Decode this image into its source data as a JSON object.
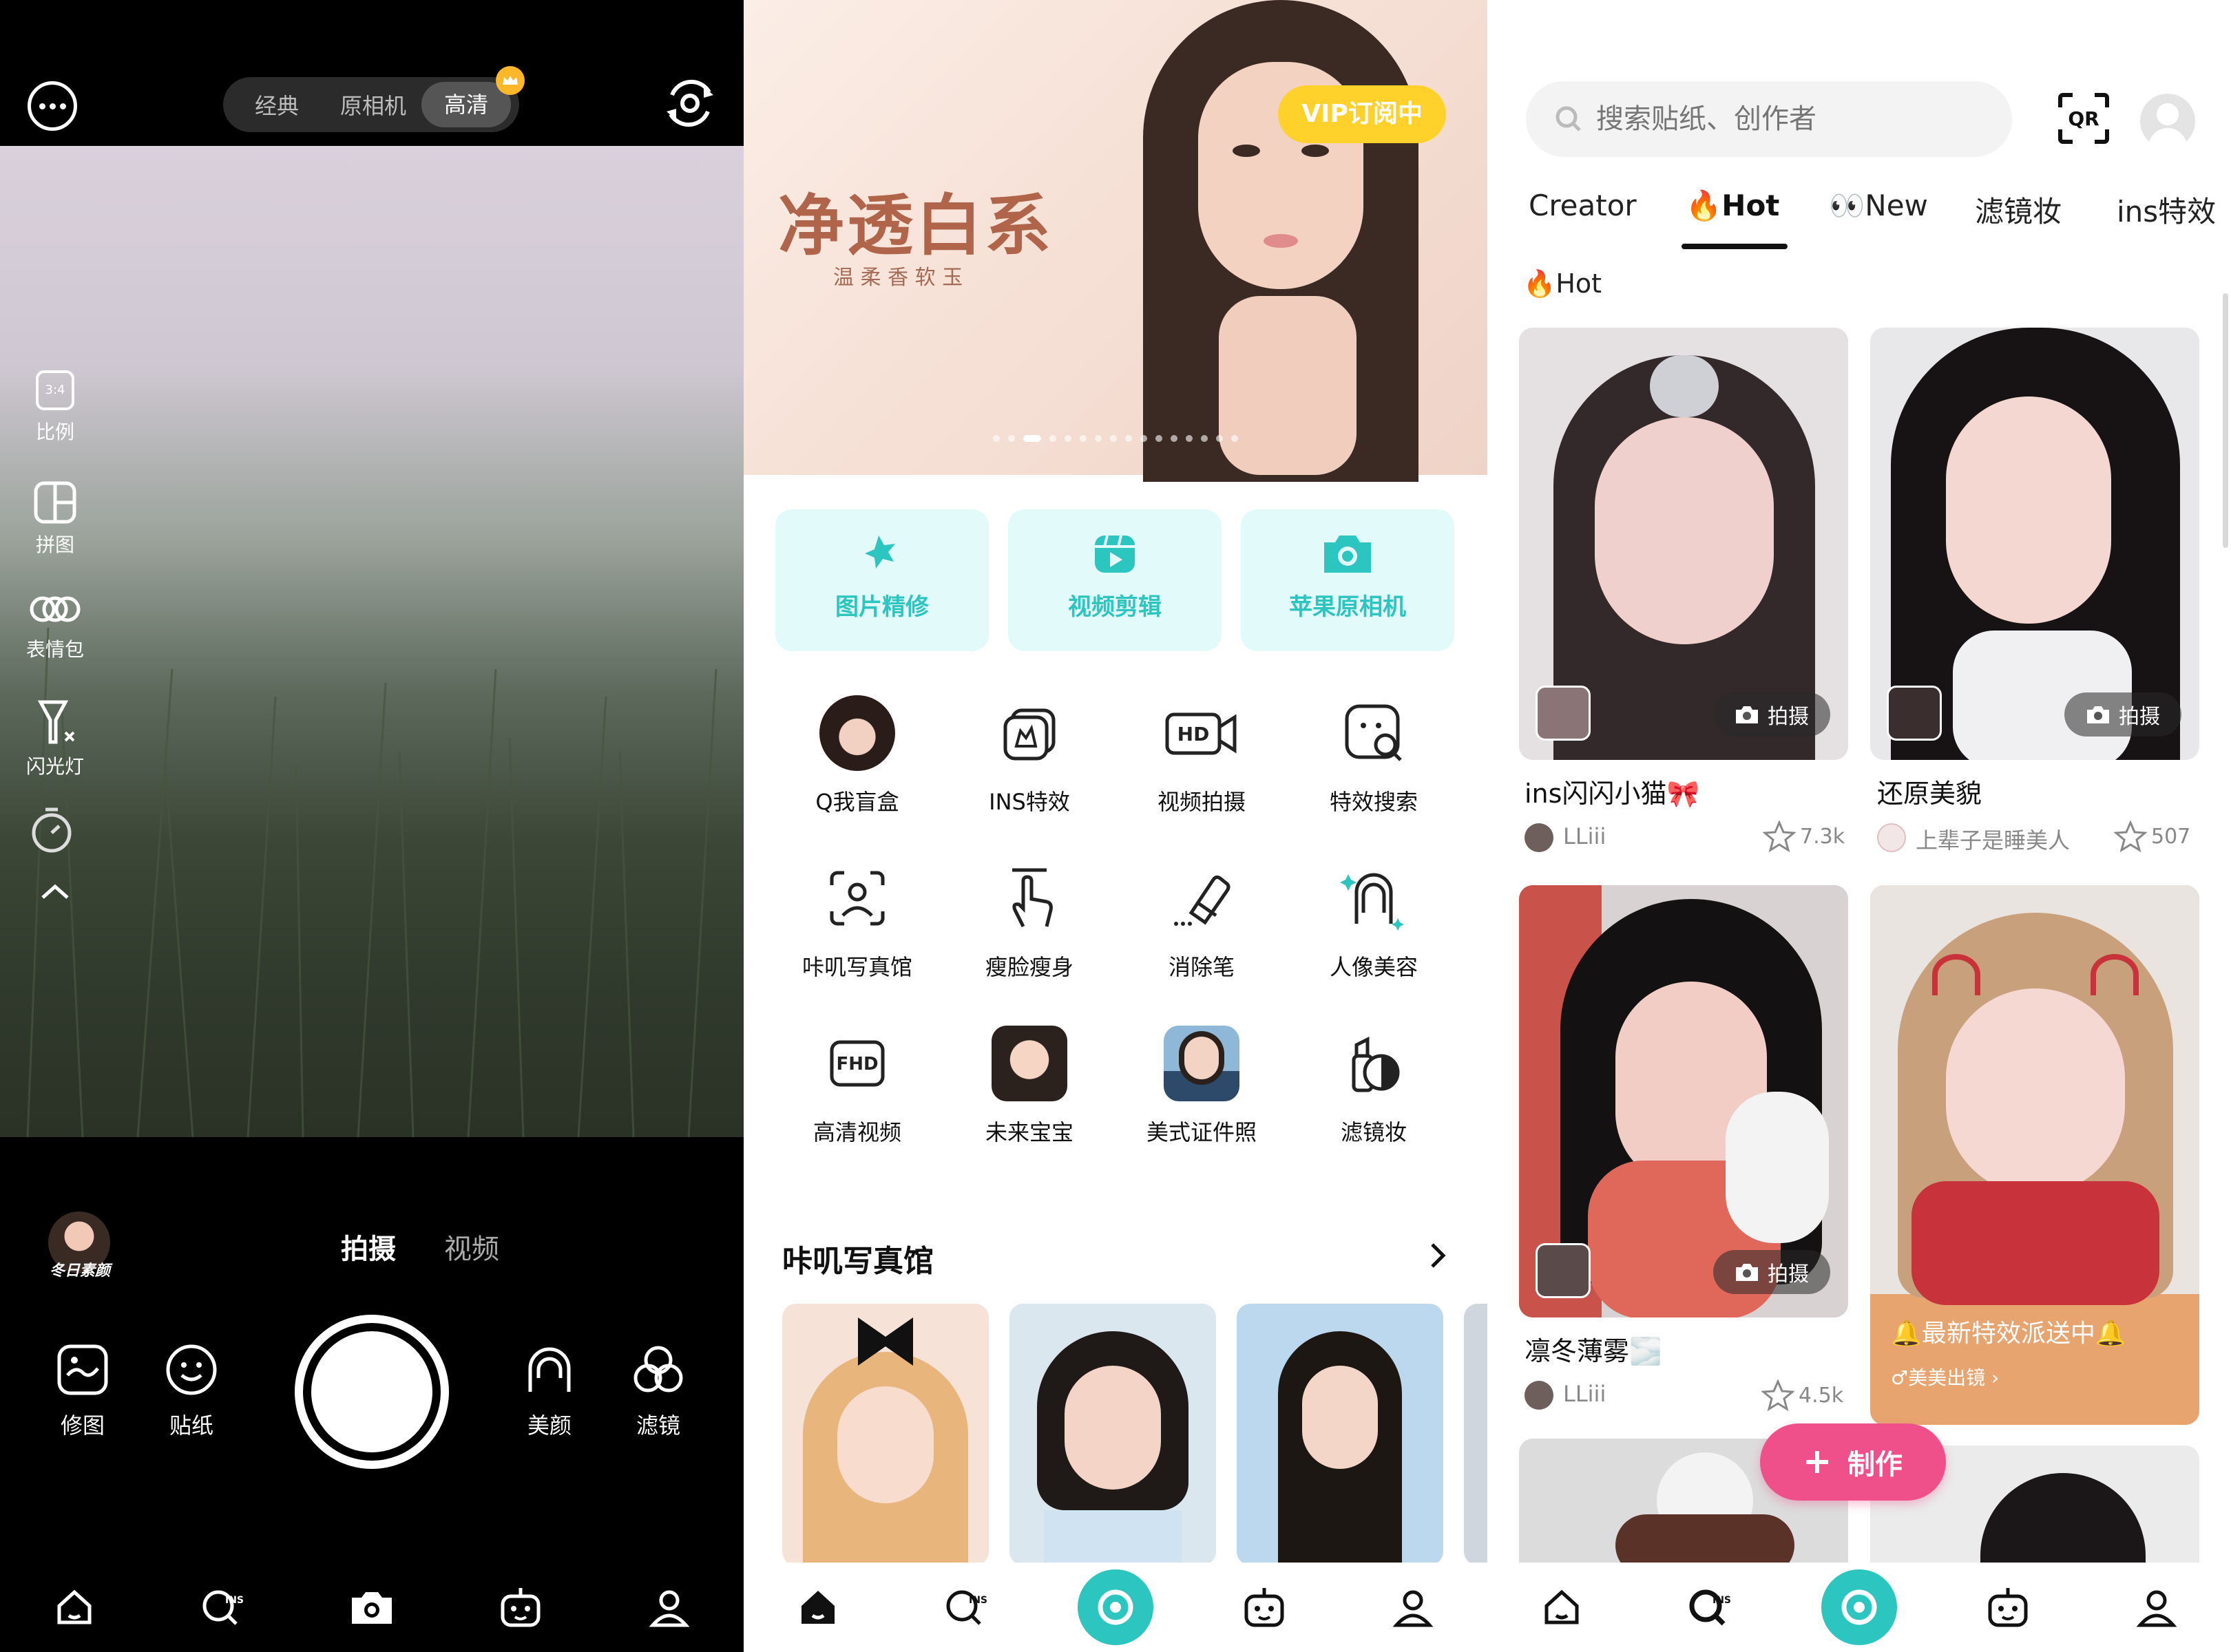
{
  "camera": {
    "mode_tabs": [
      "经典",
      "原相机",
      "高清"
    ],
    "active_mode": "高清",
    "side_tools": [
      {
        "label": "比例",
        "icon": "ratio-icon",
        "badge": "3:4"
      },
      {
        "label": "拼图",
        "icon": "collage-icon"
      },
      {
        "label": "表情包",
        "icon": "sticker-pack-icon"
      },
      {
        "label": "闪光灯",
        "icon": "flash-off-icon"
      },
      {
        "label": "",
        "icon": "timer-icon"
      }
    ],
    "avatar_caption": "冬日素颜",
    "capture_tabs": [
      "拍摄",
      "视频"
    ],
    "active_capture": "拍摄",
    "bottom_tools": [
      {
        "label": "修图",
        "icon": "edit-photo-icon"
      },
      {
        "label": "贴纸",
        "icon": "sticker-icon"
      },
      {
        "label": "美颜",
        "icon": "beauty-icon"
      },
      {
        "label": "滤镜",
        "icon": "filter-icon"
      }
    ]
  },
  "home": {
    "banner": {
      "title": "净透白系",
      "subtitle": "温 柔 香 软 玉",
      "vip_badge": "VIP订阅中",
      "page_count": 16,
      "active_page": 2
    },
    "primary_actions": [
      {
        "label": "图片精修",
        "icon": "magic-wand-icon"
      },
      {
        "label": "视频剪辑",
        "icon": "video-edit-icon"
      },
      {
        "label": "苹果原相机",
        "icon": "camera-icon"
      }
    ],
    "grid": [
      {
        "label": "Q我盲盒",
        "icon": "blind-box-icon",
        "image": true
      },
      {
        "label": "INS特效",
        "icon": "ins-effect-icon"
      },
      {
        "label": "视频拍摄",
        "icon": "hd-video-icon",
        "badge": "HD"
      },
      {
        "label": "特效搜索",
        "icon": "effect-search-icon"
      },
      {
        "label": "咔叽写真馆",
        "icon": "face-scan-icon"
      },
      {
        "label": "瘦脸瘦身",
        "icon": "slim-hand-icon"
      },
      {
        "label": "消除笔",
        "icon": "eraser-icon"
      },
      {
        "label": "人像美容",
        "icon": "portrait-icon"
      },
      {
        "label": "高清视频",
        "icon": "fhd-icon",
        "badge": "FHD"
      },
      {
        "label": "未来宝宝",
        "icon": "baby-icon",
        "image": true
      },
      {
        "label": "美式证件照",
        "icon": "id-photo-icon",
        "image": true
      },
      {
        "label": "滤镜妆",
        "icon": "makeup-icon"
      }
    ],
    "section_title": "咔叽写真馆"
  },
  "feed": {
    "search_placeholder": "搜索贴纸、创作者",
    "tabs": [
      "Creator",
      "🔥Hot",
      "👀New",
      "滤镜妆",
      "ins特效"
    ],
    "active_tab": "🔥Hot",
    "section_label": "🔥Hot",
    "capture_label": "拍摄",
    "cards": [
      {
        "title": "ins闪闪小猫🎀",
        "author": "LLiii",
        "likes": "7.3k"
      },
      {
        "title": "还原美貌",
        "author": "上辈子是睡美人",
        "likes": "507"
      },
      {
        "title": "凛冬薄雾🌫️",
        "author": "LLiii",
        "likes": "4.5k"
      }
    ],
    "promo": {
      "title": "🔔最新特效派送中🔔",
      "link": "♂美美出镜 ›"
    },
    "make_button": "制作"
  },
  "nav": {
    "items": [
      "home",
      "ins-search",
      "camera",
      "robot",
      "profile"
    ]
  },
  "colors": {
    "teal": "#2cc5c0",
    "pink": "#f0508a",
    "vip_yellow": "#ffd12a",
    "promo_orange": "#e8a46f"
  }
}
